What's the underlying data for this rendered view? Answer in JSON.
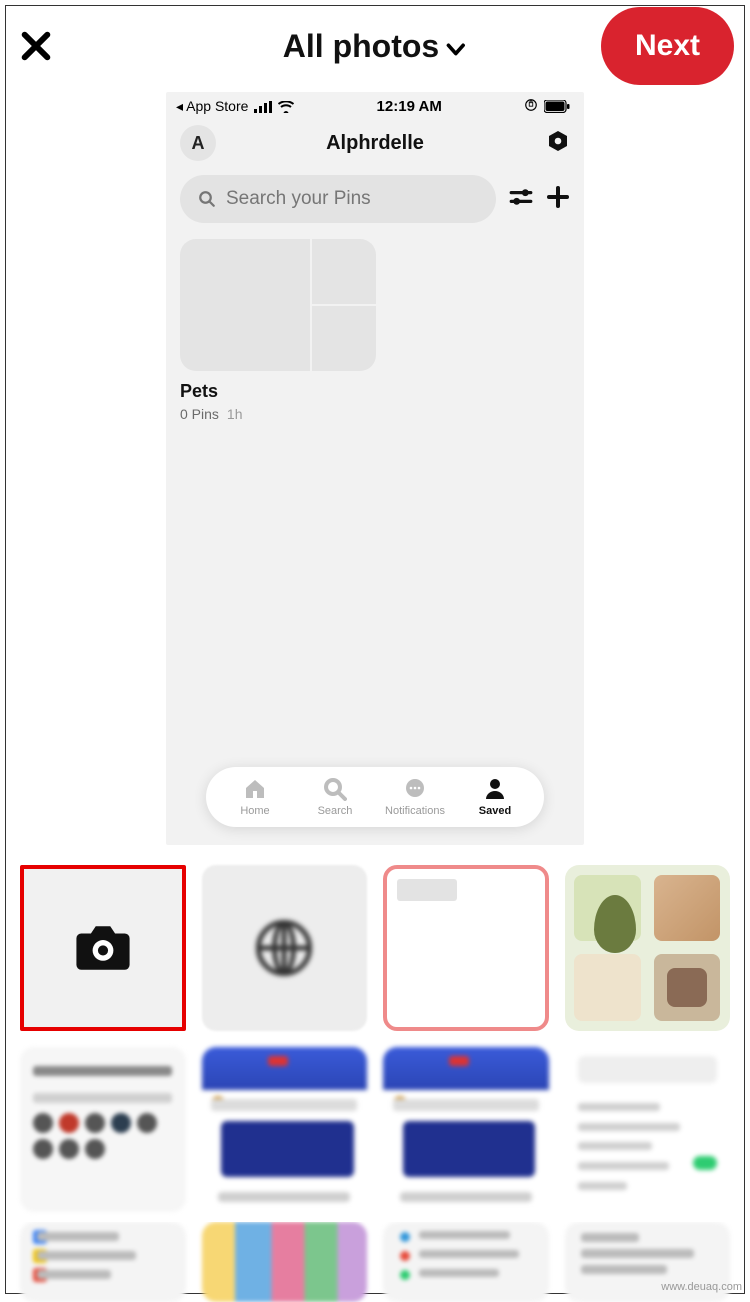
{
  "header": {
    "title": "All photos",
    "next_label": "Next"
  },
  "inner": {
    "status": {
      "back_app": "App Store",
      "time": "12:19 AM"
    },
    "profile": {
      "avatar_initial": "A",
      "username": "Alphrdelle"
    },
    "search": {
      "placeholder": "Search your Pins"
    },
    "board": {
      "name": "Pets",
      "pin_count": "0 Pins",
      "age": "1h"
    },
    "tabs": {
      "home": "Home",
      "search": "Search",
      "notifications": "Notifications",
      "saved": "Saved"
    }
  },
  "watermark": "www.deuaq.com"
}
